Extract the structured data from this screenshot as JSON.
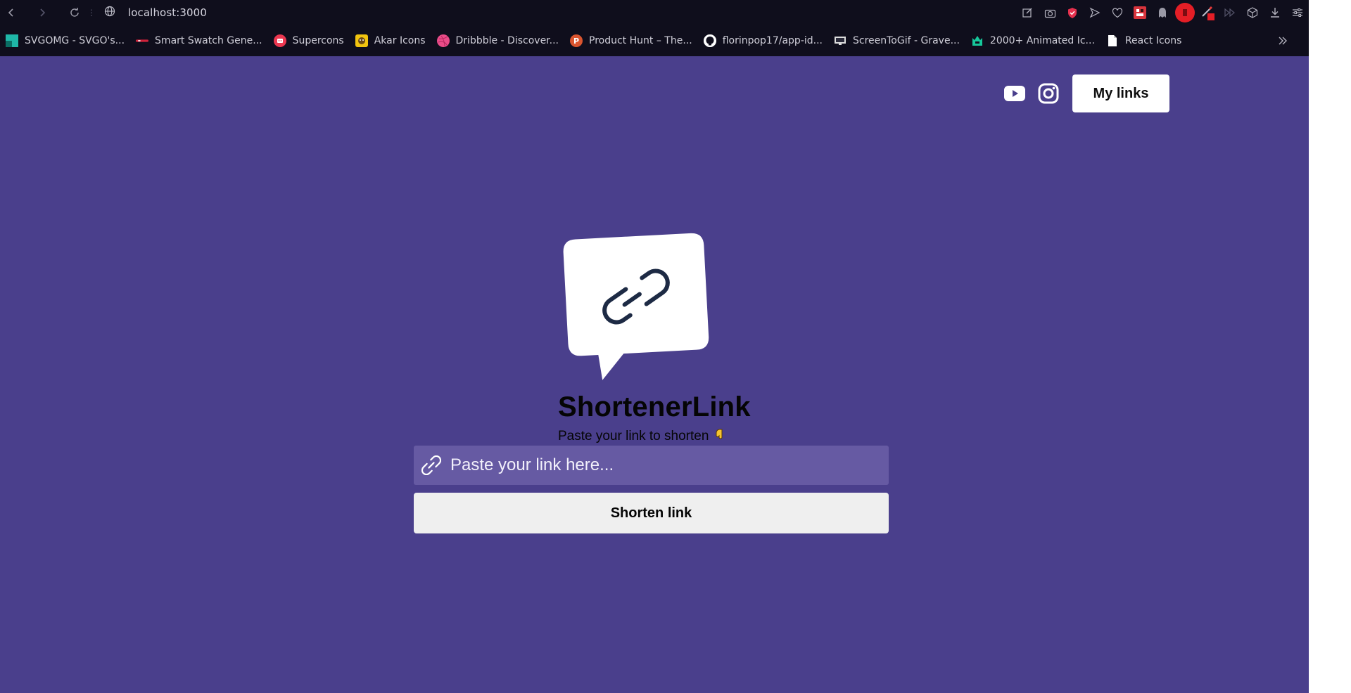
{
  "browser": {
    "url": "localhost:3000",
    "bookmarks": [
      {
        "label": "SVGOMG - SVGO's...",
        "icon": "svgomg-favicon",
        "color": "#1fb7a8"
      },
      {
        "label": "Smart Swatch Gene...",
        "icon": "smart-swatch-favicon",
        "color": "#d0233b"
      },
      {
        "label": "Supercons",
        "icon": "supercons-favicon",
        "color": "#ec3750"
      },
      {
        "label": "Akar Icons",
        "icon": "akar-icons-favicon",
        "color": "#f1c40f"
      },
      {
        "label": "Dribbble - Discover...",
        "icon": "dribbble-favicon",
        "color": "#ea4c89"
      },
      {
        "label": "Product Hunt – The...",
        "icon": "product-hunt-favicon",
        "color": "#da552f"
      },
      {
        "label": "florinpop17/app-id...",
        "icon": "github-favicon",
        "color": "#ffffff"
      },
      {
        "label": "ScreenToGif - Grave...",
        "icon": "screentogif-favicon",
        "color": "#dcdcdc"
      },
      {
        "label": "2000+ Animated Ic...",
        "icon": "animated-icons-favicon",
        "color": "#16c79a"
      },
      {
        "label": "React Icons",
        "icon": "file-favicon",
        "color": "#ffffff"
      }
    ]
  },
  "header": {
    "my_links_label": "My links"
  },
  "hero": {
    "title": "ShortenerLink",
    "subtitle": "Paste your link to shorten"
  },
  "form": {
    "input_placeholder": "Paste your link here...",
    "input_value": "",
    "submit_label": "Shorten link"
  },
  "colors": {
    "page_background": "#4a3f8c",
    "input_background": "#665aa3",
    "button_background": "#efefef",
    "browser_chrome": "#0f0e1c"
  }
}
